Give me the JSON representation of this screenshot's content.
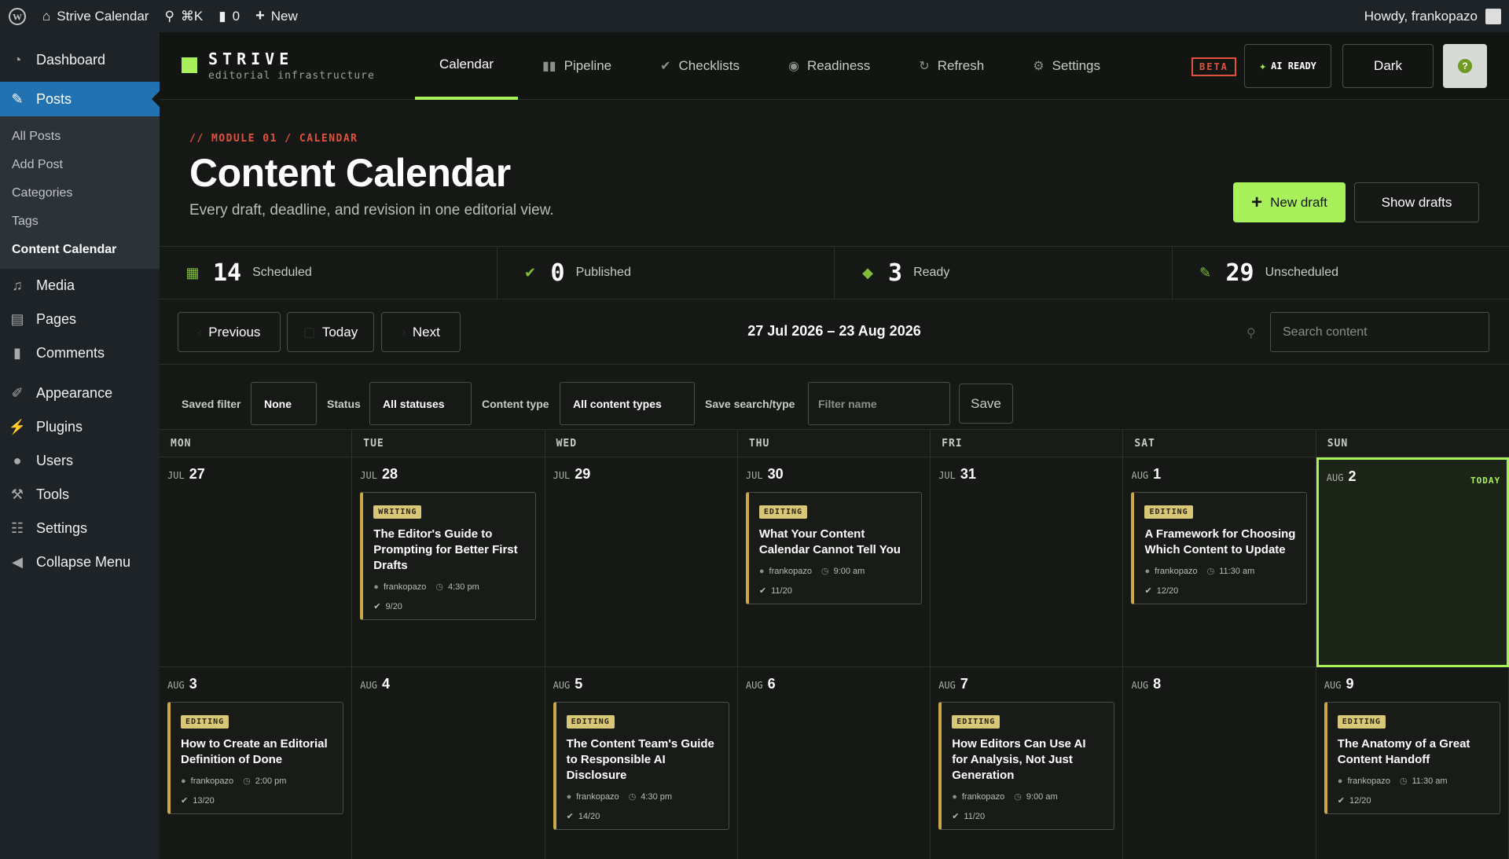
{
  "adminbar": {
    "site_name": "Strive Calendar",
    "search_shortcut": "⌘K",
    "comments_count": "0",
    "new_label": "New",
    "howdy": "Howdy, frankopazo"
  },
  "sidebar": {
    "items": [
      {
        "label": "Dashboard",
        "icon": "dashboard-icon"
      },
      {
        "label": "Posts",
        "icon": "pin-icon"
      },
      {
        "label": "Media",
        "icon": "media-icon"
      },
      {
        "label": "Pages",
        "icon": "pages-icon"
      },
      {
        "label": "Comments",
        "icon": "comments-icon"
      },
      {
        "label": "Appearance",
        "icon": "brush-icon"
      },
      {
        "label": "Plugins",
        "icon": "plugin-icon"
      },
      {
        "label": "Users",
        "icon": "users-icon"
      },
      {
        "label": "Tools",
        "icon": "wrench-icon"
      },
      {
        "label": "Settings",
        "icon": "settings-icon"
      },
      {
        "label": "Collapse Menu",
        "icon": "collapse-icon"
      }
    ],
    "posts_sub": [
      "All Posts",
      "Add Post",
      "Categories",
      "Tags",
      "Content Calendar"
    ]
  },
  "brand": {
    "name": "STRIVE",
    "tagline": "editorial infrastructure"
  },
  "tabs": [
    {
      "label": "Calendar"
    },
    {
      "label": "Pipeline"
    },
    {
      "label": "Checklists"
    },
    {
      "label": "Readiness"
    },
    {
      "label": "Refresh"
    },
    {
      "label": "Settings"
    }
  ],
  "header_buttons": {
    "beta": "BETA",
    "ai_ready": "AI READY",
    "theme": "Dark",
    "help": "?"
  },
  "page": {
    "module": "// MODULE 01 / CALENDAR",
    "title": "Content Calendar",
    "subtitle": "Every draft, deadline, and revision in one editorial view.",
    "new_draft": "New draft",
    "show_drafts": "Show drafts"
  },
  "stats": [
    {
      "value": "14",
      "label": "Scheduled"
    },
    {
      "value": "0",
      "label": "Published"
    },
    {
      "value": "3",
      "label": "Ready"
    },
    {
      "value": "29",
      "label": "Unscheduled"
    }
  ],
  "nav": {
    "previous": "Previous",
    "today": "Today",
    "next": "Next",
    "range": "27 Jul 2026 – 23 Aug 2026",
    "search_placeholder": "Search content"
  },
  "filters": {
    "saved_filter_label": "Saved filter",
    "saved_filter_value": "None",
    "status_label": "Status",
    "status_value": "All statuses",
    "type_label": "Content type",
    "type_value": "All content types",
    "save_search_label": "Save search/type",
    "filter_name_placeholder": "Filter name",
    "save": "Save"
  },
  "calendar": {
    "weekdays": [
      "MON",
      "TUE",
      "WED",
      "THU",
      "FRI",
      "SAT",
      "SUN"
    ],
    "today_label": "TODAY",
    "weeks": [
      [
        {
          "month": "JUL",
          "day": "27"
        },
        {
          "month": "JUL",
          "day": "28",
          "card": {
            "status": "WRITING",
            "title": "The Editor's Guide to Prompting for Better First Drafts",
            "author": "frankopazo",
            "time": "4:30 pm",
            "score": "9/20"
          }
        },
        {
          "month": "JUL",
          "day": "29"
        },
        {
          "month": "JUL",
          "day": "30",
          "card": {
            "status": "EDITING",
            "title": "What Your Content Calendar Cannot Tell You",
            "author": "frankopazo",
            "time": "9:00 am",
            "score": "11/20"
          }
        },
        {
          "month": "JUL",
          "day": "31"
        },
        {
          "month": "AUG",
          "day": "1",
          "card": {
            "status": "EDITING",
            "title": "A Framework for Choosing Which Content to Update",
            "author": "frankopazo",
            "time": "11:30 am",
            "score": "12/20"
          }
        },
        {
          "month": "AUG",
          "day": "2",
          "today": true
        }
      ],
      [
        {
          "month": "AUG",
          "day": "3",
          "card": {
            "status": "EDITING",
            "title": "How to Create an Editorial Definition of Done",
            "author": "frankopazo",
            "time": "2:00 pm",
            "score": "13/20"
          }
        },
        {
          "month": "AUG",
          "day": "4"
        },
        {
          "month": "AUG",
          "day": "5",
          "card": {
            "status": "EDITING",
            "title": "The Content Team's Guide to Responsible AI Disclosure",
            "author": "frankopazo",
            "time": "4:30 pm",
            "score": "14/20"
          }
        },
        {
          "month": "AUG",
          "day": "6"
        },
        {
          "month": "AUG",
          "day": "7",
          "card": {
            "status": "EDITING",
            "title": "How Editors Can Use AI for Analysis, Not Just Generation",
            "author": "frankopazo",
            "time": "9:00 am",
            "score": "11/20"
          }
        },
        {
          "month": "AUG",
          "day": "8"
        },
        {
          "month": "AUG",
          "day": "9",
          "card": {
            "status": "EDITING",
            "title": "The Anatomy of a Great Content Handoff",
            "author": "frankopazo",
            "time": "11:30 am",
            "score": "12/20"
          }
        }
      ]
    ]
  },
  "colors": {
    "accent": "#a8f15a",
    "beta": "#e0523b",
    "card_border": "#c9a646",
    "wp_blue": "#2271b1"
  }
}
